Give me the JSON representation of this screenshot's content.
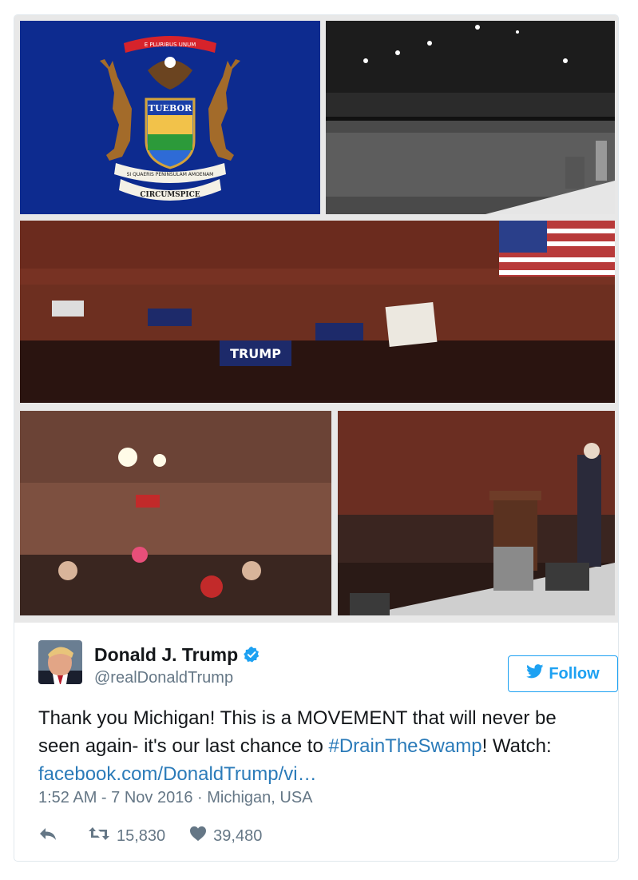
{
  "tweet": {
    "author": {
      "name": "Donald J. Trump",
      "handle": "@realDonaldTrump",
      "verified": true
    },
    "follow_label": "Follow",
    "text": {
      "part1": "Thank you Michigan! This is a MOVEMENT that will never be seen again- it's our last chance to ",
      "hashtag": "#DrainTheSwamp",
      "part2": "! Watch: ",
      "link": "facebook.com/DonaldTrump/vi…"
    },
    "timestamp": "1:52 AM - 7 Nov 2016 · Michigan, USA",
    "retweets": "15,830",
    "likes": "39,480"
  },
  "media": {
    "flag": {
      "banner_top": "E PLURIBUS UNUM",
      "shield_word": "TUEBOR",
      "scroll_motto": "SI QUAERIS PENINSULAM AMOENAM",
      "scroll_bottom": "CIRCUMSPICE"
    },
    "sign_text": "TRUMP"
  },
  "colors": {
    "accent": "#1da1f2",
    "link": "#2b7bb9",
    "muted": "#657786",
    "flag_blue": "#0b2a8a"
  }
}
